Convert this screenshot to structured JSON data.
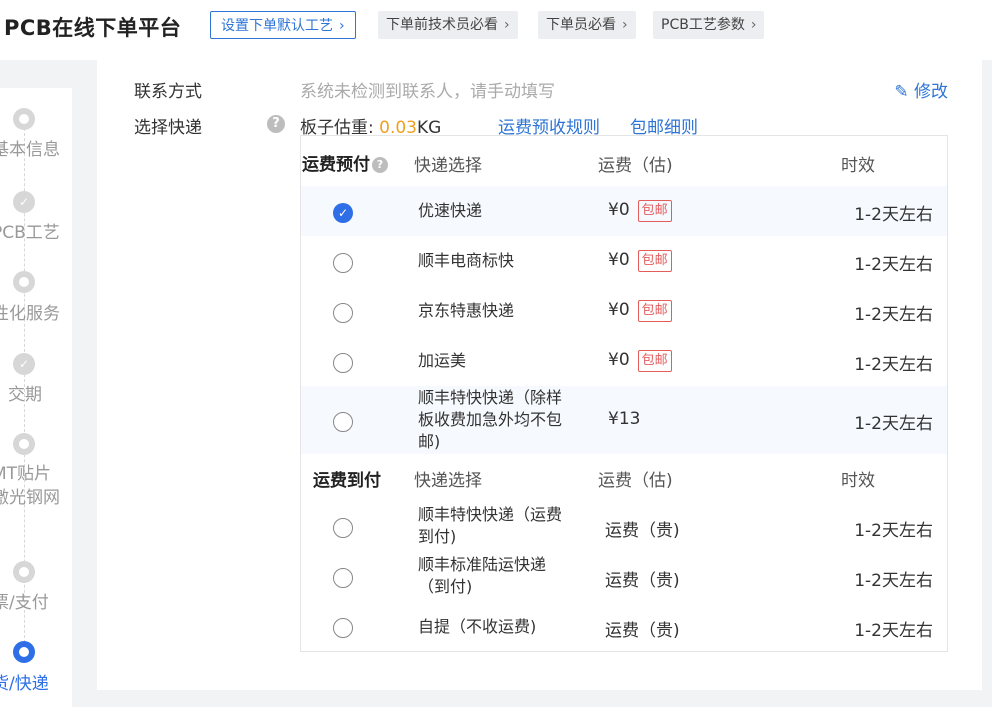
{
  "header": {
    "title": "PCB在线下单平台",
    "default_process_btn": "设置下单默认工艺",
    "crumbs": [
      "下单前技术员必看",
      "下单员必看",
      "PCB工艺参数"
    ]
  },
  "sidebar": {
    "steps": [
      {
        "label": "基本信息",
        "state": "pending"
      },
      {
        "label": "PCB工艺",
        "state": "done"
      },
      {
        "label": "性化服务",
        "state": "pending"
      },
      {
        "label": "交期",
        "state": "done"
      },
      {
        "label": "MT贴片",
        "label2": "激光钢网",
        "state": "pending"
      },
      {
        "label": "票/支付",
        "state": "pending"
      },
      {
        "label": "货/快递",
        "state": "active"
      }
    ]
  },
  "contact": {
    "label": "联系方式",
    "value": "系统未检测到联系人，请手动填写",
    "edit": "修改"
  },
  "shipping": {
    "label": "选择快递",
    "weight_label": "板子估重:",
    "weight_value": "0.03",
    "weight_unit": "KG",
    "link_rules": "运费预收规则",
    "link_free": "包邮细则",
    "prepaid": {
      "title": "运费预付",
      "col_courier": "快递选择",
      "col_fee": "运费（估)",
      "col_time": "时效",
      "rows": [
        {
          "name": "优速快递",
          "price": "¥0",
          "badge": "包邮",
          "time": "1-2天左右",
          "checked": true
        },
        {
          "name": "顺丰电商标快",
          "price": "¥0",
          "badge": "包邮",
          "time": "1-2天左右",
          "checked": false
        },
        {
          "name": "京东特惠快递",
          "price": "¥0",
          "badge": "包邮",
          "time": "1-2天左右",
          "checked": false
        },
        {
          "name": "加运美",
          "price": "¥0",
          "badge": "包邮",
          "time": "1-2天左右",
          "checked": false
        },
        {
          "name": "顺丰特快快递（除样板收费加急外均不包邮)",
          "price": "¥13",
          "badge": "",
          "time": "1-2天左右",
          "checked": false
        }
      ]
    },
    "cod": {
      "title": "运费到付",
      "col_courier": "快递选择",
      "col_fee": "运费（估)",
      "col_time": "时效",
      "rows": [
        {
          "name": "顺丰特快快递（运费到付)",
          "price": "运费（贵)",
          "time": "1-2天左右"
        },
        {
          "name": "顺丰标准陆运快递 （到付)",
          "price": "运费（贵)",
          "time": "1-2天左右"
        },
        {
          "name": "自提（不收运费)",
          "price": "运费（贵)",
          "time": "1-2天左右"
        }
      ]
    }
  }
}
